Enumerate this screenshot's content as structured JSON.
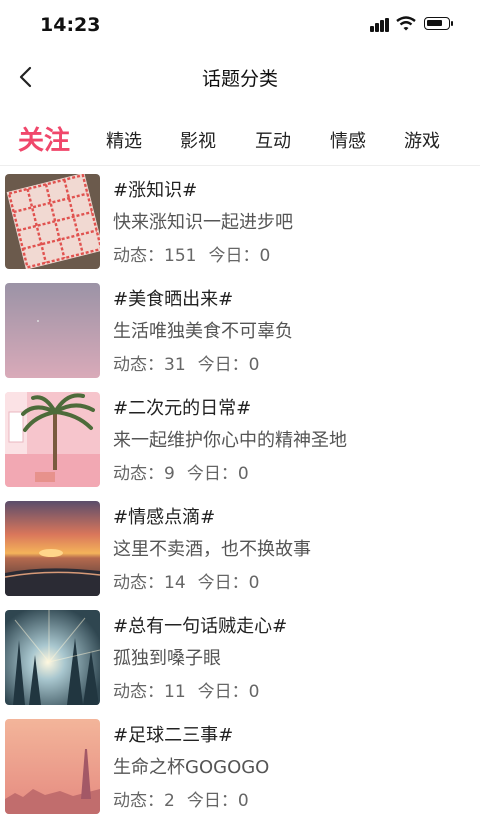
{
  "status_bar": {
    "time": "14:23"
  },
  "header": {
    "title": "话题分类"
  },
  "tabs": [
    {
      "label": "关注",
      "active": true
    },
    {
      "label": "精选"
    },
    {
      "label": "影视"
    },
    {
      "label": "互动"
    },
    {
      "label": "情感"
    },
    {
      "label": "游戏"
    }
  ],
  "colors": {
    "accent": "#f0476b"
  },
  "topics": [
    {
      "title": "#涨知识#",
      "desc": "快来涨知识一起进步吧",
      "posts_label": "动态：151",
      "today_label": "今日：0",
      "thumb": "knitted-pattern-image"
    },
    {
      "title": "#美食晒出来#",
      "desc": "生活唯独美食不可辜负",
      "posts_label": "动态：31",
      "today_label": "今日：0",
      "thumb": "pink-gradient-image"
    },
    {
      "title": "#二次元的日常#",
      "desc": "来一起维护你心中的精神圣地",
      "posts_label": "动态：9",
      "today_label": "今日：0",
      "thumb": "pink-room-palm-image"
    },
    {
      "title": "#情感点滴#",
      "desc": "这里不卖酒，也不换故事",
      "posts_label": "动态：14",
      "today_label": "今日：0",
      "thumb": "sunset-beach-image"
    },
    {
      "title": "#总有一句话贼走心#",
      "desc": "孤独到嗓子眼",
      "posts_label": "动态：11",
      "today_label": "今日：0",
      "thumb": "forest-sunbeam-image"
    },
    {
      "title": "#足球二三事#",
      "desc": "生命之杯GOGOGO",
      "posts_label": "动态：2",
      "today_label": "今日：0",
      "thumb": "paris-skyline-image"
    }
  ]
}
